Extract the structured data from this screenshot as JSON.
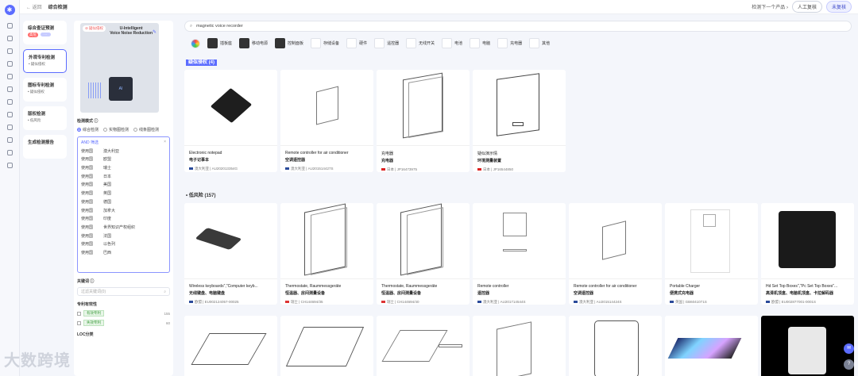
{
  "topbar": {
    "back": "← 返回",
    "title": "综合检测",
    "next": "检测下一个产品 ›",
    "manual": "人工复核",
    "unread": "未复核"
  },
  "side_cards": [
    {
      "title": "综合查证预测",
      "badge": "高危",
      "badge2": "···"
    },
    {
      "title": "外观专利检测",
      "sub": "• 疑似侵权"
    },
    {
      "title": "图标专利检测",
      "sub": "• 疑似侵权"
    },
    {
      "title": "版权检测",
      "sub": "• 低风险"
    },
    {
      "title": "生成检测报告"
    }
  ],
  "filter": {
    "preview_tag": "⊘ 疑似侵权",
    "preview_title": "U-Intelligent\nVoice Noise Reduction",
    "mode_label": "检测模式 ⓘ",
    "modes": [
      "综合检测",
      "实物图检测",
      "线条图检测"
    ],
    "and_label": "AND 筛选",
    "countries": [
      [
        "使用国",
        "澳大利亚"
      ],
      [
        "使用国",
        "欧盟"
      ],
      [
        "使用国",
        "瑞士"
      ],
      [
        "使用国",
        "日本"
      ],
      [
        "使用国",
        "美国"
      ],
      [
        "使用国",
        "英国"
      ],
      [
        "使用国",
        "德国"
      ],
      [
        "使用国",
        "加拿大"
      ],
      [
        "使用国",
        "印度"
      ],
      [
        "使用国",
        "世界知识产权组织"
      ],
      [
        "使用国",
        "法国"
      ],
      [
        "使用国",
        "以色列"
      ],
      [
        "使用国",
        "巴西"
      ]
    ],
    "keyword_label": "关键词 ⓘ",
    "keyword_placeholder": "过滤关键词(0)",
    "validity_label": "专利有效性",
    "validity": [
      {
        "label": "有效专利",
        "count": "155"
      },
      {
        "label": "失效专利",
        "count": "60"
      }
    ],
    "loc_label": "LOC分类"
  },
  "search": {
    "query": "magnetic voice recorder"
  },
  "chips": [
    "插板座",
    "移动电源",
    "控制面板",
    "存储设备",
    "硬件",
    "遥控器",
    "无线开关",
    "电池",
    "电脑",
    "充电器",
    "其他"
  ],
  "group1": {
    "label": "疑似侵权",
    "count": "(4)"
  },
  "group2": {
    "label": "低风险",
    "count": "(157)"
  },
  "row1": [
    {
      "t1": "Electronic notepad",
      "t2": "电子记事本",
      "country": "澳大利亚",
      "code": "AU202013354G",
      "flag": "au"
    },
    {
      "t1": "Remote controller for air conditioner",
      "t2": "空调遥控器",
      "country": "澳大利亚",
      "code": "AU201514427S",
      "flag": "au"
    },
    {
      "t1": "充电器",
      "t2": "充电器",
      "country": "日本",
      "code": "JP16473975",
      "flag": "jp"
    },
    {
      "t1": "疑似演示情",
      "t2": "环境测量装置",
      "country": "日本",
      "code": "JP16544850",
      "flag": "jp"
    }
  ],
  "row2": [
    {
      "t1": "Wireless keyboards\",\"Computer keyb...",
      "t2": "无线键盘、电脑键盘",
      "country": "欧盟",
      "code": "EU002124057-00025",
      "flag": "eu"
    },
    {
      "t1": "Thermostate, Raummessgeräte",
      "t2": "恒温器、房间测量设备",
      "country": "瑞士",
      "code": "CH144694/35",
      "flag": "ch"
    },
    {
      "t1": "Thermostate, Raummessgeräte",
      "t2": "恒温器、房间测量设备",
      "country": "瑞士",
      "code": "CH144694/40",
      "flag": "ch"
    },
    {
      "t1": "Remote controller",
      "t2": "遥控器",
      "country": "澳大利亚",
      "code": "AU201714544S",
      "flag": "au"
    },
    {
      "t1": "Remote controller for air conditioner",
      "t2": "空调遥控器",
      "country": "澳大利亚",
      "code": "AU201514424S",
      "flag": "au"
    },
    {
      "t1": "Portable Charger",
      "t2": "便携式充电器",
      "country": "英国",
      "code": "GB6041071S",
      "flag": "gb"
    },
    {
      "t1": "Hd Set Top Boxes\",\"Pc Set Top Boxes\"...",
      "t2": "高清机顶盒、电脑机顶盒、卡拉解码器",
      "country": "欧盟",
      "code": "EU002877001-0001S",
      "flag": "eu"
    }
  ],
  "watermark": "大数跨境",
  "colors": {
    "accent": "#5b6cff",
    "danger": "#ff6a6a"
  },
  "icons": [
    "logo-icon",
    "search-icon",
    "edit-icon",
    "close-icon",
    "chat-icon",
    "help-icon"
  ]
}
